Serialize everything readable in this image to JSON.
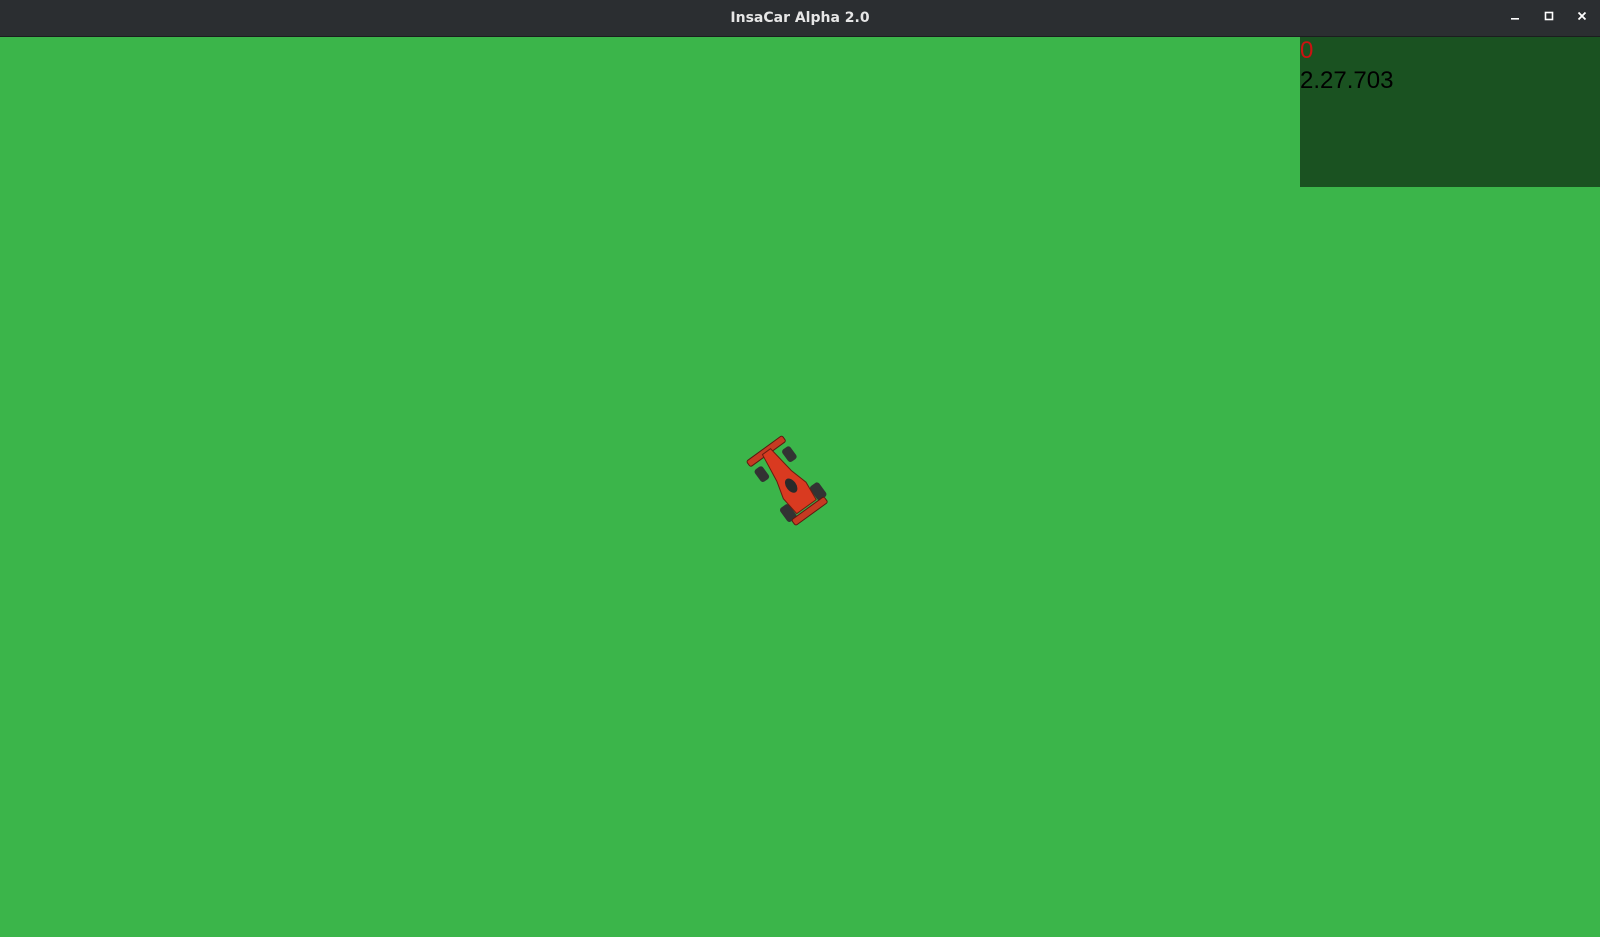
{
  "window": {
    "title": "InsaCar Alpha 2.0",
    "minimize_icon": "minimize-icon",
    "maximize_icon": "maximize-icon",
    "close_icon": "close-icon"
  },
  "hud": {
    "lap_count": "0",
    "lap_time": "2.27.703"
  },
  "colors": {
    "grass": "#3bb54a",
    "asphalt": "#686868",
    "curb_red": "#ff0000",
    "curb_white": "#ffffff",
    "titlebar": "#2b2e31",
    "lap_count_text": "#cc1111",
    "lap_time_text": "#000000",
    "car_body": "#d93a20"
  }
}
